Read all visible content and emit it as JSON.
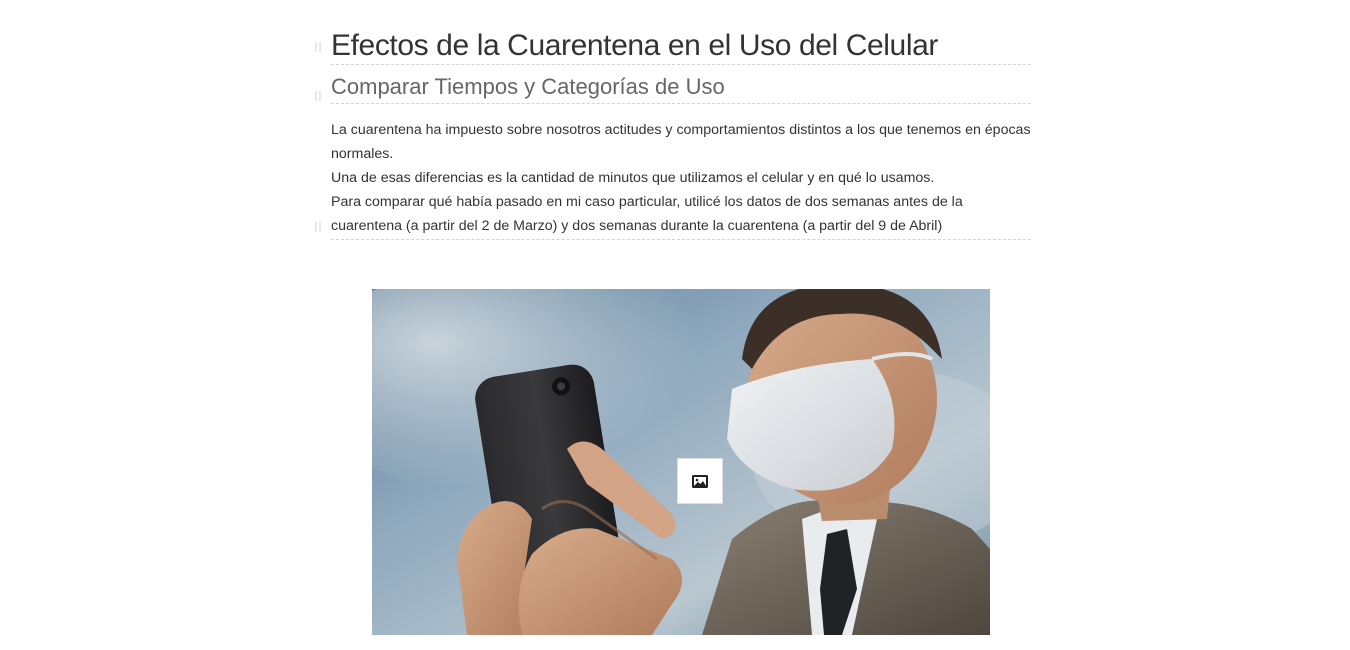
{
  "story": {
    "title": "Efectos de la Cuarentena en el Uso del Celular",
    "subtitle": "Comparar Tiempos y Categorías de Uso",
    "paragraphs": [
      "La cuarentena ha impuesto sobre nosotros actitudes y comportamientos distintos a los que tenemos en épocas normales.",
      "Una de esas diferencias es la cantidad de minutos que utilizamos el celular y en qué lo usamos.",
      "Para comparar qué había pasado en mi caso particular, utilicé los datos de dos semanas antes de la cuarentena (a partir del 2 de Marzo) y dos semanas durante la cuarentena (a partir del 9 de Abril)"
    ]
  },
  "media": {
    "image_subject": "man-with-face-mask-using-phone-photo",
    "badge_icon": "image-icon"
  },
  "colors": {
    "title": "#333333",
    "subtitle": "#666666",
    "divider": "#d4d4d4"
  }
}
